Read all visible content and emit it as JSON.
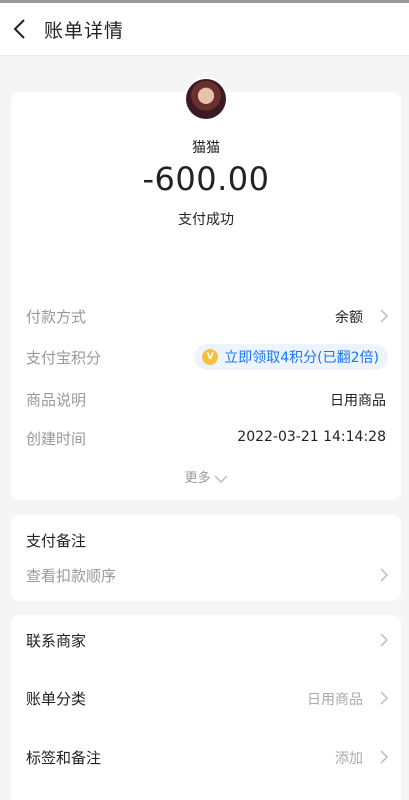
{
  "header": {
    "title": "账单详情"
  },
  "summary": {
    "payee": "猫猫",
    "amount": "-600.00",
    "status": "支付成功"
  },
  "details": [
    {
      "label": "付款方式",
      "value": "余额"
    },
    {
      "label": "支付宝积分",
      "value": "立即领取4积分(已翻2倍)"
    },
    {
      "label": "商品说明",
      "value": "日用商品"
    },
    {
      "label": "创建时间",
      "value": "2022-03-21 14:14:28"
    }
  ],
  "more_label": "更多",
  "remark": {
    "title": "支付备注",
    "link": "查看扣款顺序"
  },
  "actions": [
    {
      "label": "联系商家",
      "value": ""
    },
    {
      "label": "账单分类",
      "value": "日用商品"
    },
    {
      "label": "标签和备注",
      "value": "添加"
    }
  ],
  "colors": {
    "accent": "#1677ff",
    "points_bg": "#eef4fd",
    "coin": "#f2c13d"
  }
}
